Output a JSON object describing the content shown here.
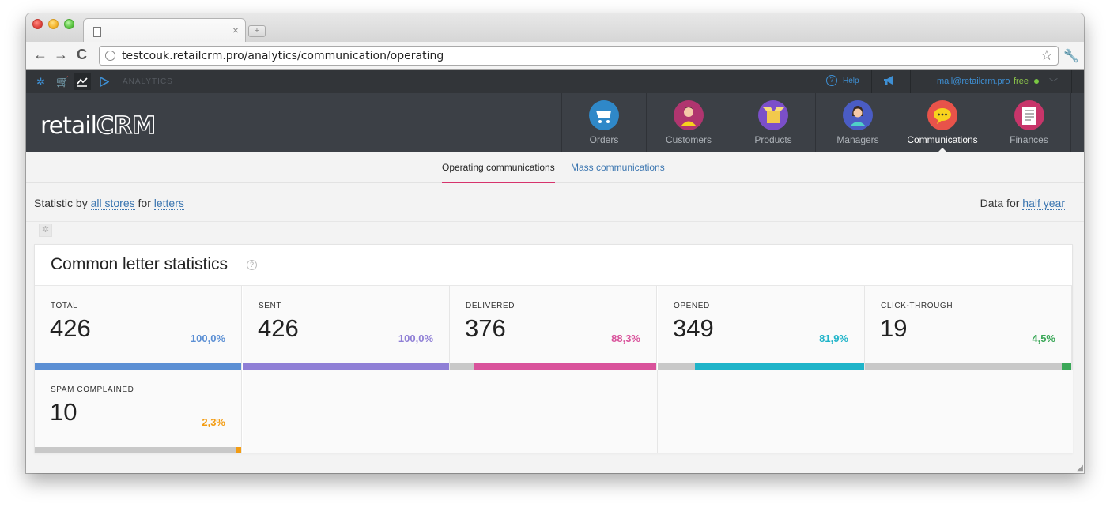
{
  "browser": {
    "url": "testcouk.retailcrm.pro/analytics/communication/operating",
    "tab_close": "×",
    "new_tab": "+"
  },
  "appbar": {
    "section_label": "ANALYTICS",
    "help_label": "Help",
    "user_email": "mail@retailcrm.pro",
    "plan": "free"
  },
  "logo": {
    "prefix": "retail",
    "suffix": "CRM"
  },
  "nav": [
    {
      "label": "Orders",
      "icon": "cart-icon",
      "color": "#2f88c8"
    },
    {
      "label": "Customers",
      "icon": "customer-avatar-icon",
      "color": "#b0356f"
    },
    {
      "label": "Products",
      "icon": "box-icon",
      "color": "#7b4fc9"
    },
    {
      "label": "Managers",
      "icon": "manager-avatar-icon",
      "color": "#4a5cc4"
    },
    {
      "label": "Communications",
      "icon": "chat-bubble-icon",
      "color": "#e8534a"
    },
    {
      "label": "Finances",
      "icon": "ledger-icon",
      "color": "#c8356a"
    }
  ],
  "subnav": {
    "active": "Operating communications",
    "other": "Mass communications"
  },
  "filter": {
    "prefix": "Statistic by",
    "stores_link": "all stores",
    "mid": "for",
    "type_link": "letters",
    "period_prefix": "Data for",
    "period_link": "half year"
  },
  "panel": {
    "title": "Common letter statistics",
    "stats": [
      {
        "label": "TOTAL",
        "value": "426",
        "pct": "100,0%",
        "fraction": 1.0,
        "color": "#5b8fd4"
      },
      {
        "label": "SENT",
        "value": "426",
        "pct": "100,0%",
        "fraction": 1.0,
        "color": "#8f7fd6"
      },
      {
        "label": "DELIVERED",
        "value": "376",
        "pct": "88,3%",
        "fraction": 0.883,
        "color": "#d9529b"
      },
      {
        "label": "OPENED",
        "value": "349",
        "pct": "81,9%",
        "fraction": 0.819,
        "color": "#1fb4c9"
      },
      {
        "label": "CLICK-THROUGH",
        "value": "19",
        "pct": "4,5%",
        "fraction": 0.045,
        "color": "#3aa757"
      },
      {
        "label": "SPAM COMPLAINED",
        "value": "10",
        "pct": "2,3%",
        "fraction": 0.023,
        "color": "#f39c12"
      }
    ]
  }
}
